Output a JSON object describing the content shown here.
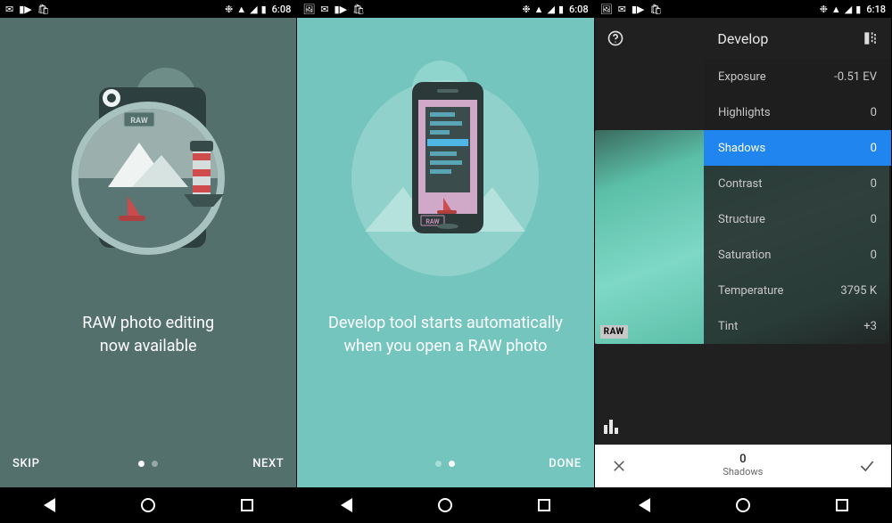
{
  "status": {
    "t1": "6:08",
    "t2": "6:08",
    "t3": "6:18"
  },
  "screen1": {
    "line1": "RAW photo editing",
    "line2": "now available",
    "skip": "SKIP",
    "next": "NEXT",
    "badge": "RAW"
  },
  "screen2": {
    "line1": "Develop tool starts automatically",
    "line2": "when you open a RAW photo",
    "done": "DONE",
    "badge": "RAW"
  },
  "develop": {
    "title": "Develop",
    "rows": [
      {
        "name": "Exposure",
        "value": "-0.51 EV",
        "selected": false
      },
      {
        "name": "Highlights",
        "value": "0",
        "selected": false
      },
      {
        "name": "Shadows",
        "value": "0",
        "selected": true
      },
      {
        "name": "Contrast",
        "value": "0",
        "selected": false
      },
      {
        "name": "Structure",
        "value": "0",
        "selected": false
      },
      {
        "name": "Saturation",
        "value": "0",
        "selected": false
      },
      {
        "name": "Temperature",
        "value": "3795 K",
        "selected": false
      },
      {
        "name": "Tint",
        "value": "+3",
        "selected": false
      }
    ],
    "raw_badge": "RAW",
    "footer_value": "0",
    "footer_label": "Shadows"
  }
}
